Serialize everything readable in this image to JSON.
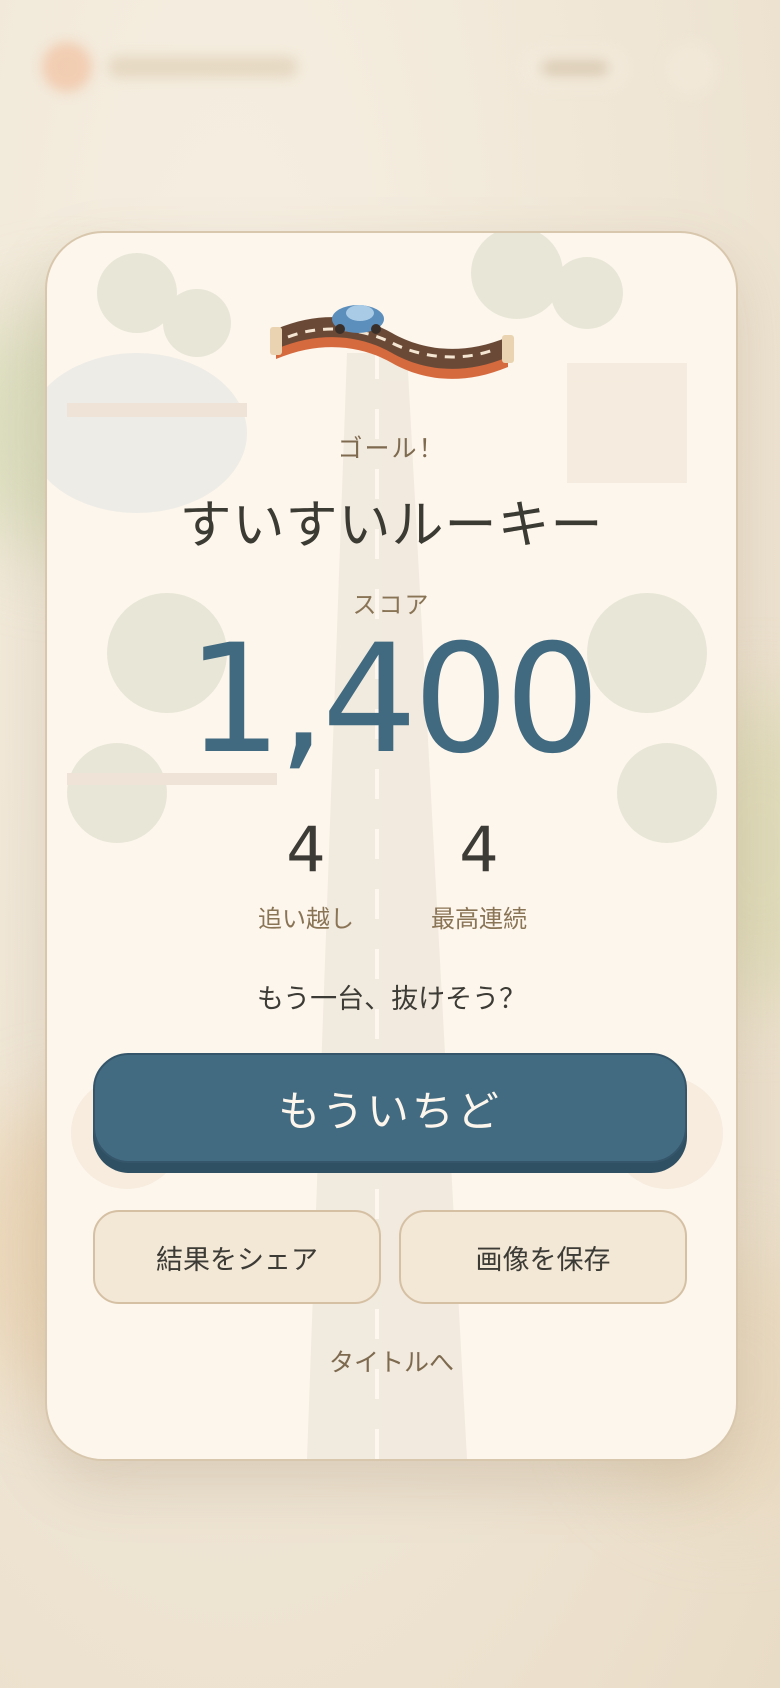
{
  "result": {
    "goal_label": "ゴール！",
    "rank_title": "すいすいルーキー",
    "score_label": "スコア",
    "score": "1,400",
    "stats": [
      {
        "value": "4",
        "label": "追い越し"
      },
      {
        "value": "4",
        "label": "最高連続"
      }
    ],
    "prompt": "もう一台、抜けそう？"
  },
  "actions": {
    "retry_label": "もういちど",
    "share_label": "結果をシェア",
    "save_label": "画像を保存",
    "title_label": "タイトルへ"
  },
  "colors": {
    "accent": "#426b82",
    "card_background": "#fdf6ec",
    "page_background": "#f1e7d8",
    "muted_text": "#7e6a4f"
  }
}
